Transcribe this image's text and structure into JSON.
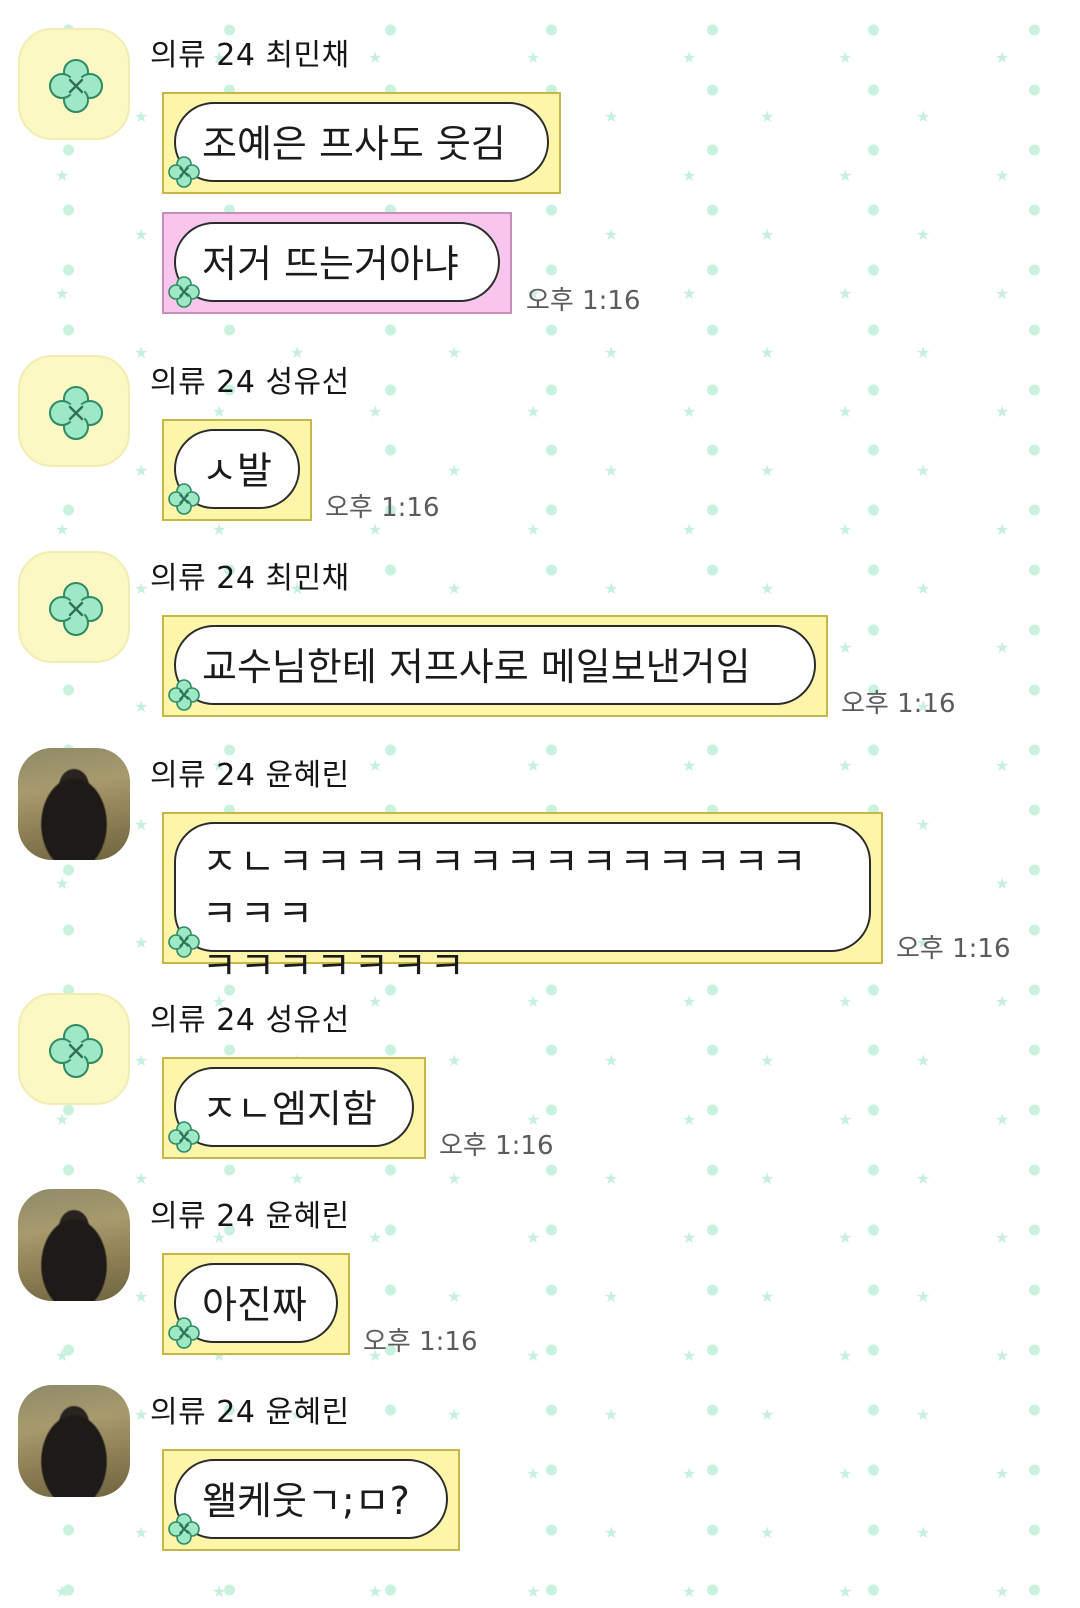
{
  "chat": {
    "theme": {
      "frame_yellow": "#fdf6a8",
      "frame_pink": "#f8c6ec",
      "clover_color": "#9ee8c6",
      "star_color": "#c7f0dc"
    },
    "messages": [
      {
        "sender": "의류 24 최민채",
        "avatar": "clover-icon",
        "bubbles": [
          {
            "text": "조예은 프사도 웃김",
            "frame": "yellow"
          },
          {
            "text": "저거 뜨는거아냐",
            "frame": "pink",
            "time": "오후 1:16"
          }
        ]
      },
      {
        "sender": "의류 24 성유선",
        "avatar": "clover-icon",
        "bubbles": [
          {
            "text": "ㅅ발",
            "frame": "yellow",
            "time": "오후 1:16"
          }
        ]
      },
      {
        "sender": "의류 24 최민채",
        "avatar": "clover-icon",
        "bubbles": [
          {
            "text": "교수님한테 저프사로 메일보낸거임",
            "frame": "yellow",
            "time": "오후 1:16"
          }
        ]
      },
      {
        "sender": "의류 24 윤혜린",
        "avatar": "photo",
        "bubbles": [
          {
            "lines": [
              "ㅈㄴㅋㅋㅋㅋㅋㅋㅋㅋㅋㅋㅋㅋㅋㅋㅋㅋㅋ",
              "ㅋㅋㅋㅋㅋㅋㅋ"
            ],
            "frame": "yellow",
            "time": "오후 1:16"
          }
        ]
      },
      {
        "sender": "의류 24 성유선",
        "avatar": "clover-icon",
        "bubbles": [
          {
            "text": "ㅈㄴ엠지함",
            "frame": "yellow",
            "time": "오후 1:16"
          }
        ]
      },
      {
        "sender": "의류 24 윤혜린",
        "avatar": "photo",
        "bubbles": [
          {
            "text": "아진짜",
            "frame": "yellow",
            "time": "오후 1:16"
          }
        ]
      },
      {
        "sender": "의류 24 윤혜린",
        "avatar": "photo",
        "bubbles": [
          {
            "text": "왤케웃ㄱ;ㅁ?",
            "frame": "yellow"
          }
        ]
      }
    ]
  }
}
